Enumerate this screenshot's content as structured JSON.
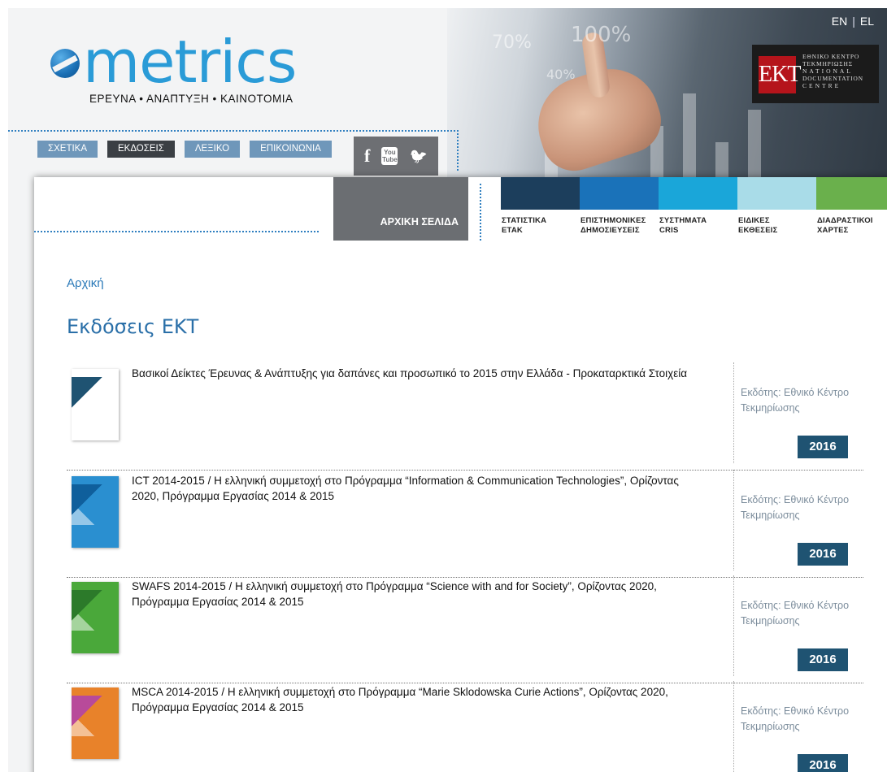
{
  "site": {
    "logo_text": "metrics",
    "logo_sub": "ΕΡΕΥΝΑ • ΑΝΑΠΤΥΞΗ • ΚΑΙΝΟΤΟΜΙΑ"
  },
  "header": {
    "photo_texts": [
      "70%",
      "100%",
      "40%"
    ],
    "lang": {
      "en": "EN",
      "separator": "|",
      "el": "EL"
    },
    "ekt_logo": "EKT",
    "ekt_text": [
      "ΕΘΝΙΚΟ ΚΕΝΤΡΟ",
      "ΤΕΚΜΗΡΙΩΣΗΣ",
      "NATIONAL",
      "DOCUMENTATION",
      "CENTRE"
    ]
  },
  "topnav": [
    {
      "label": "ΣΧΕΤΙΚΑ",
      "active": false
    },
    {
      "label": "ΕΚΔΟΣΕΙΣ",
      "active": true
    },
    {
      "label": "ΛΕΞΙΚΟ",
      "active": false
    },
    {
      "label": "ΕΠΙΚΟΙΝΩΝΙΑ",
      "active": false
    }
  ],
  "social": [
    {
      "icon": "facebook-icon",
      "glyph": "f"
    },
    {
      "icon": "youtube-icon",
      "glyph": "You Tube"
    },
    {
      "icon": "twitter-icon",
      "glyph": "🐦"
    }
  ],
  "home_button": "ΑΡΧΙΚΗ ΣΕΛΙΔΑ",
  "categories": [
    {
      "line1": "ΣΤΑΤΙΣΤΙΚΑ",
      "line2": "ΕΤΑΚ",
      "color": "#1c3e5c"
    },
    {
      "line1": "ΕΠΙΣΤΗΜΟΝΙΚΕΣ",
      "line2": "ΔΗΜΟΣΙΕΥΣΕΙΣ",
      "color": "#1a72b9"
    },
    {
      "line1": "ΣΥΣΤΗΜΑΤΑ",
      "line2": "CRIS",
      "color": "#1aa6d9"
    },
    {
      "line1": "ΕΙΔΙΚΕΣ",
      "line2": "ΕΚΘΕΣΕΙΣ",
      "color": "#a9dce8"
    },
    {
      "line1": "ΔΙΑΔΡΑΣΤΙΚΟΙ",
      "line2": "ΧΑΡΤΕΣ",
      "color": "#6ab04c"
    }
  ],
  "breadcrumb": "Αρχική",
  "page_title": "Εκδόσεις ΕΚΤ",
  "publications": [
    {
      "title": "Βασικοί Δείκτες Έρευνας & Ανάπτυξης για δαπάνες και προσωπικό το 2015 στην Ελλάδα - Προκαταρκτικά Στοιχεία",
      "publisher": "Εκδότης: Εθνικό Κέντρο Τεκμηρίωσης",
      "year": "2016",
      "thumb_color": "#ffffff",
      "thumb_accent": "#1f5372"
    },
    {
      "title": "ICT 2014-2015 / Η ελληνική συμμετοχή στο Πρόγραμμα “Information & Communication Technologies”, Ορίζοντας 2020, Πρόγραμμα Εργασίας 2014 & 2015",
      "publisher": "Εκδότης: Εθνικό Κέντρο Τεκμηρίωσης",
      "year": "2016",
      "thumb_color": "#2a8fd0",
      "thumb_accent": "#0f5f9c"
    },
    {
      "title": "SWAFS 2014-2015 / Η ελληνική συμμετοχή στο Πρόγραμμα “Science with and for Society”, Ορίζοντας 2020, Πρόγραμμα Εργασίας 2014 & 2015",
      "publisher": "Εκδότης: Εθνικό Κέντρο Τεκμηρίωσης",
      "year": "2016",
      "thumb_color": "#4aa83a",
      "thumb_accent": "#2c7a2a"
    },
    {
      "title": "MSCA 2014-2015 / Η ελληνική συμμετοχή στο Πρόγραμμα “Marie Sklodowska Curie Actions”, Ορίζοντας 2020, Πρόγραμμα Εργασίας 2014 & 2015",
      "publisher": "Εκδότης: Εθνικό Κέντρο Τεκμηρίωσης",
      "year": "2016",
      "thumb_color": "#e8822a",
      "thumb_accent": "#b84a9a"
    }
  ]
}
